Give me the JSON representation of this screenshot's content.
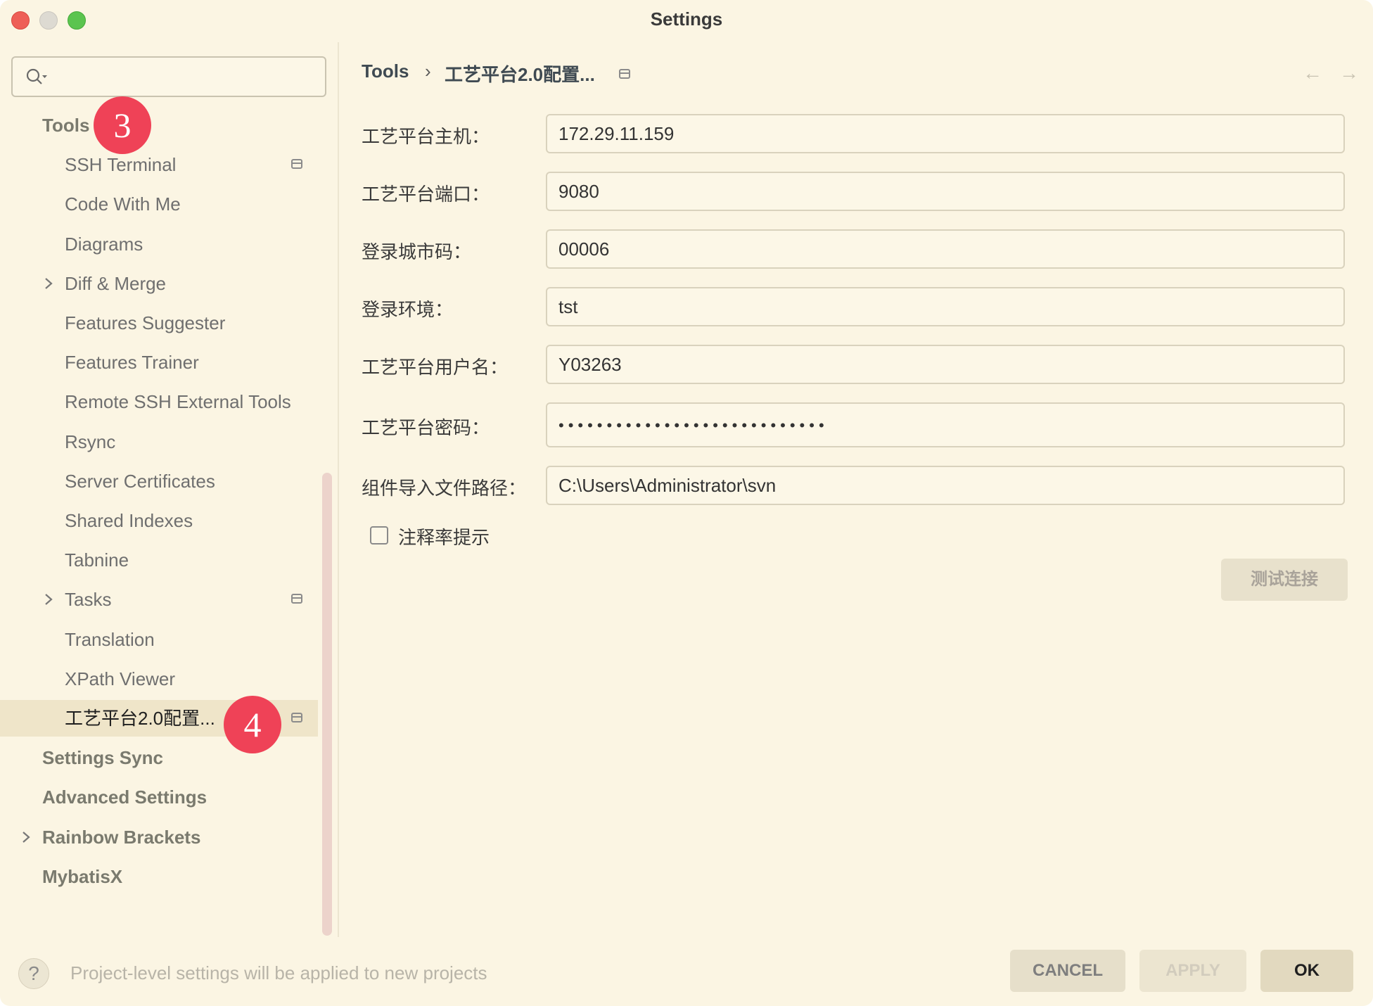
{
  "window": {
    "title": "Settings"
  },
  "sidebar": {
    "search": {
      "placeholder": ""
    },
    "items": [
      {
        "label": "Tools",
        "level": 0
      },
      {
        "label": "SSH Terminal",
        "level": 1,
        "project_icon": true
      },
      {
        "label": "Code With Me",
        "level": 1
      },
      {
        "label": "Diagrams",
        "level": 1
      },
      {
        "label": "Diff & Merge",
        "level": 1,
        "expandable": true
      },
      {
        "label": "Features Suggester",
        "level": 1
      },
      {
        "label": "Features Trainer",
        "level": 1
      },
      {
        "label": "Remote SSH External Tools",
        "level": 1
      },
      {
        "label": "Rsync",
        "level": 1
      },
      {
        "label": "Server Certificates",
        "level": 1
      },
      {
        "label": "Shared Indexes",
        "level": 1
      },
      {
        "label": "Tabnine",
        "level": 1
      },
      {
        "label": "Tasks",
        "level": 1,
        "expandable": true,
        "project_icon": true
      },
      {
        "label": "Translation",
        "level": 1
      },
      {
        "label": "XPath Viewer",
        "level": 1
      },
      {
        "label": "工艺平台2.0配置...",
        "level": 1,
        "selected": true,
        "project_icon": true
      },
      {
        "label": "Settings Sync",
        "level": 0
      },
      {
        "label": "Advanced Settings",
        "level": 0
      },
      {
        "label": "Rainbow Brackets",
        "level": 0,
        "expandable": true
      },
      {
        "label": "MybatisX",
        "level": 0
      }
    ]
  },
  "annotations": {
    "badge_3": "3",
    "badge_4": "4"
  },
  "breadcrumb": {
    "parent": "Tools",
    "separator": "›",
    "current": "工艺平台2.0配置..."
  },
  "nav": {
    "back": "←",
    "forward": "→"
  },
  "form": {
    "host": {
      "label": "工艺平台主机：",
      "value": "172.29.11.159"
    },
    "port": {
      "label": "工艺平台端口：",
      "value": "9080"
    },
    "city_code": {
      "label": "登录城市码：",
      "value": "00006"
    },
    "env": {
      "label": "登录环境：",
      "value": "tst"
    },
    "username": {
      "label": "工艺平台用户名：",
      "value": "Y03263"
    },
    "password": {
      "label": "工艺平台密码：",
      "value": "••••••••••••••••••••••••••••"
    },
    "import_path": {
      "label": "组件导入文件路径：",
      "value": "C:\\Users\\Administrator\\svn"
    },
    "comment_rate": {
      "label": "注释率提示",
      "checked": false
    },
    "test_button": "测试连接"
  },
  "footer": {
    "help": "?",
    "note": "Project-level settings will be applied to new projects",
    "cancel": "CANCEL",
    "apply": "APPLY",
    "ok": "OK"
  }
}
